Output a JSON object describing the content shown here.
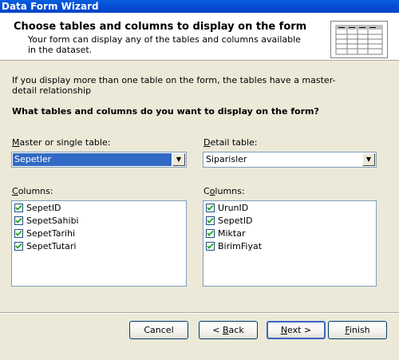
{
  "window": {
    "title": "Data Form Wizard"
  },
  "header": {
    "title": "Choose tables and columns to display on the form",
    "subtitle": "Your form can display any of the tables and columns available in the dataset."
  },
  "info_text": "If you display more than one table on the form, the tables have a master-detail relationship",
  "question": "What tables and columns do you want to display on the form?",
  "master": {
    "label_pre": "",
    "label_mn": "M",
    "label_post": "aster or single table:",
    "selected": "Sepetler",
    "columns_label_pre": "",
    "columns_label_mn": "C",
    "columns_label_post": "olumns:",
    "columns": [
      {
        "label": "SepetID",
        "checked": true
      },
      {
        "label": "SepetSahibi",
        "checked": true
      },
      {
        "label": "SepetTarihi",
        "checked": true
      },
      {
        "label": "SepetTutari",
        "checked": true
      }
    ]
  },
  "detail": {
    "label_pre": "",
    "label_mn": "D",
    "label_post": "etail table:",
    "selected": "Siparisler",
    "columns_label_pre": "C",
    "columns_label_mn": "o",
    "columns_label_post": "lumns:",
    "columns": [
      {
        "label": "UrunID",
        "checked": true
      },
      {
        "label": "SepetID",
        "checked": true
      },
      {
        "label": "Miktar",
        "checked": true
      },
      {
        "label": "BirimFiyat",
        "checked": true
      }
    ]
  },
  "buttons": {
    "cancel": "Cancel",
    "back_pre": "< ",
    "back_mn": "B",
    "back_post": "ack",
    "next_mn": "N",
    "next_post": "ext >",
    "finish_mn": "F",
    "finish_post": "inish"
  },
  "icons": {
    "dropdown": "chevron-down-icon",
    "check": "checkmark-icon",
    "header": "table-grid-icon"
  },
  "colors": {
    "titlebar": "#0550D8",
    "selection": "#316AC5",
    "dialog_bg": "#ECE9D8"
  }
}
